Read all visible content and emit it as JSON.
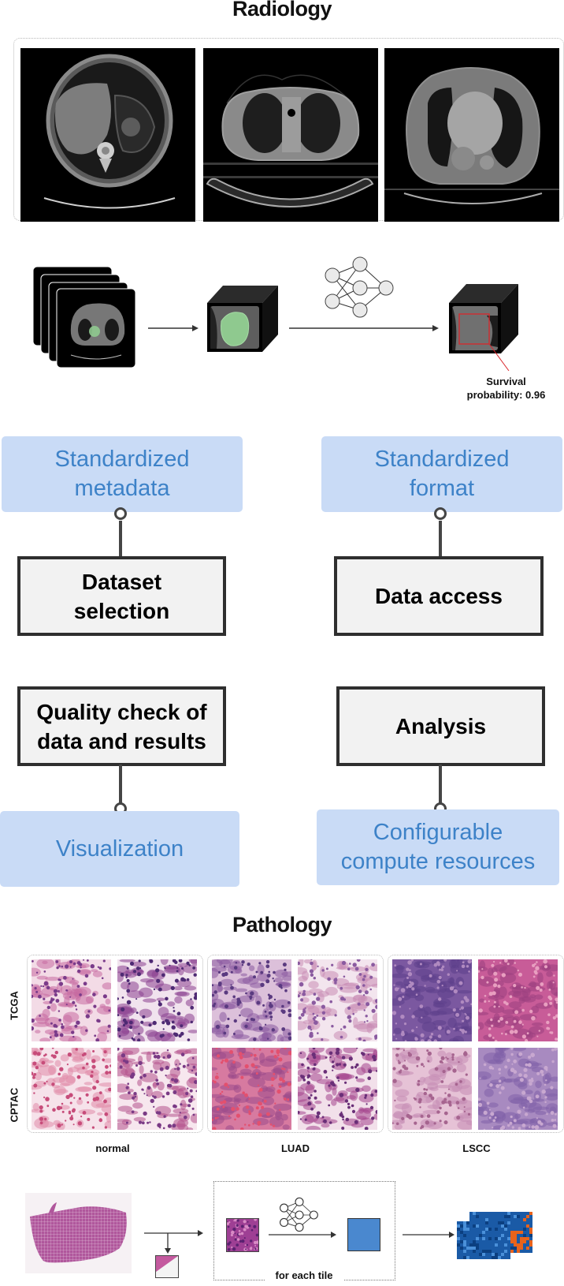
{
  "radiology": {
    "title": "Radiology",
    "ct_scans": [
      {
        "name": "ct-scan-abdomen"
      },
      {
        "name": "ct-scan-upper-chest"
      },
      {
        "name": "ct-scan-heart-level"
      }
    ],
    "pipeline": {
      "input_label": "stacked CT slices",
      "segmentation_label": "segmented tumor volume",
      "model_icon": "neural-network-icon",
      "output_label": "Survival probability: 0.96",
      "output_line1": "Survival",
      "output_line2": "probability: 0.96"
    }
  },
  "workflow": {
    "top": [
      {
        "blue": [
          "Standardized",
          "metadata"
        ],
        "gray": [
          "Dataset",
          "selection"
        ]
      },
      {
        "blue": [
          "Standardized",
          "format"
        ],
        "gray": [
          "Data access"
        ]
      }
    ],
    "bottom": [
      {
        "gray": [
          "Quality check of",
          "data and results"
        ],
        "blue": [
          "Visualization"
        ]
      },
      {
        "gray": [
          "Analysis"
        ],
        "blue": [
          "Configurable",
          "compute resources"
        ]
      }
    ]
  },
  "pathology": {
    "title": "Pathology",
    "rows": [
      "TCGA",
      "CPTAC"
    ],
    "groups": [
      "normal",
      "LUAD",
      "LSCC"
    ],
    "pipeline": {
      "loop_label": "for each tile",
      "model_icon": "neural-network-icon"
    }
  },
  "colors": {
    "blue_box_bg": "#c9dbf6",
    "blue_box_text": "#3d82c8",
    "gray_box_bg": "#f2f2f2",
    "gray_box_border": "#2f2f2f",
    "segmentation_green": "#8fc98f",
    "highlight_red": "#d9262b",
    "embedding_blue": "#4a88cf",
    "heatmap_orange": "#e8631c",
    "heatmap_blue": "#1a5aa6"
  }
}
